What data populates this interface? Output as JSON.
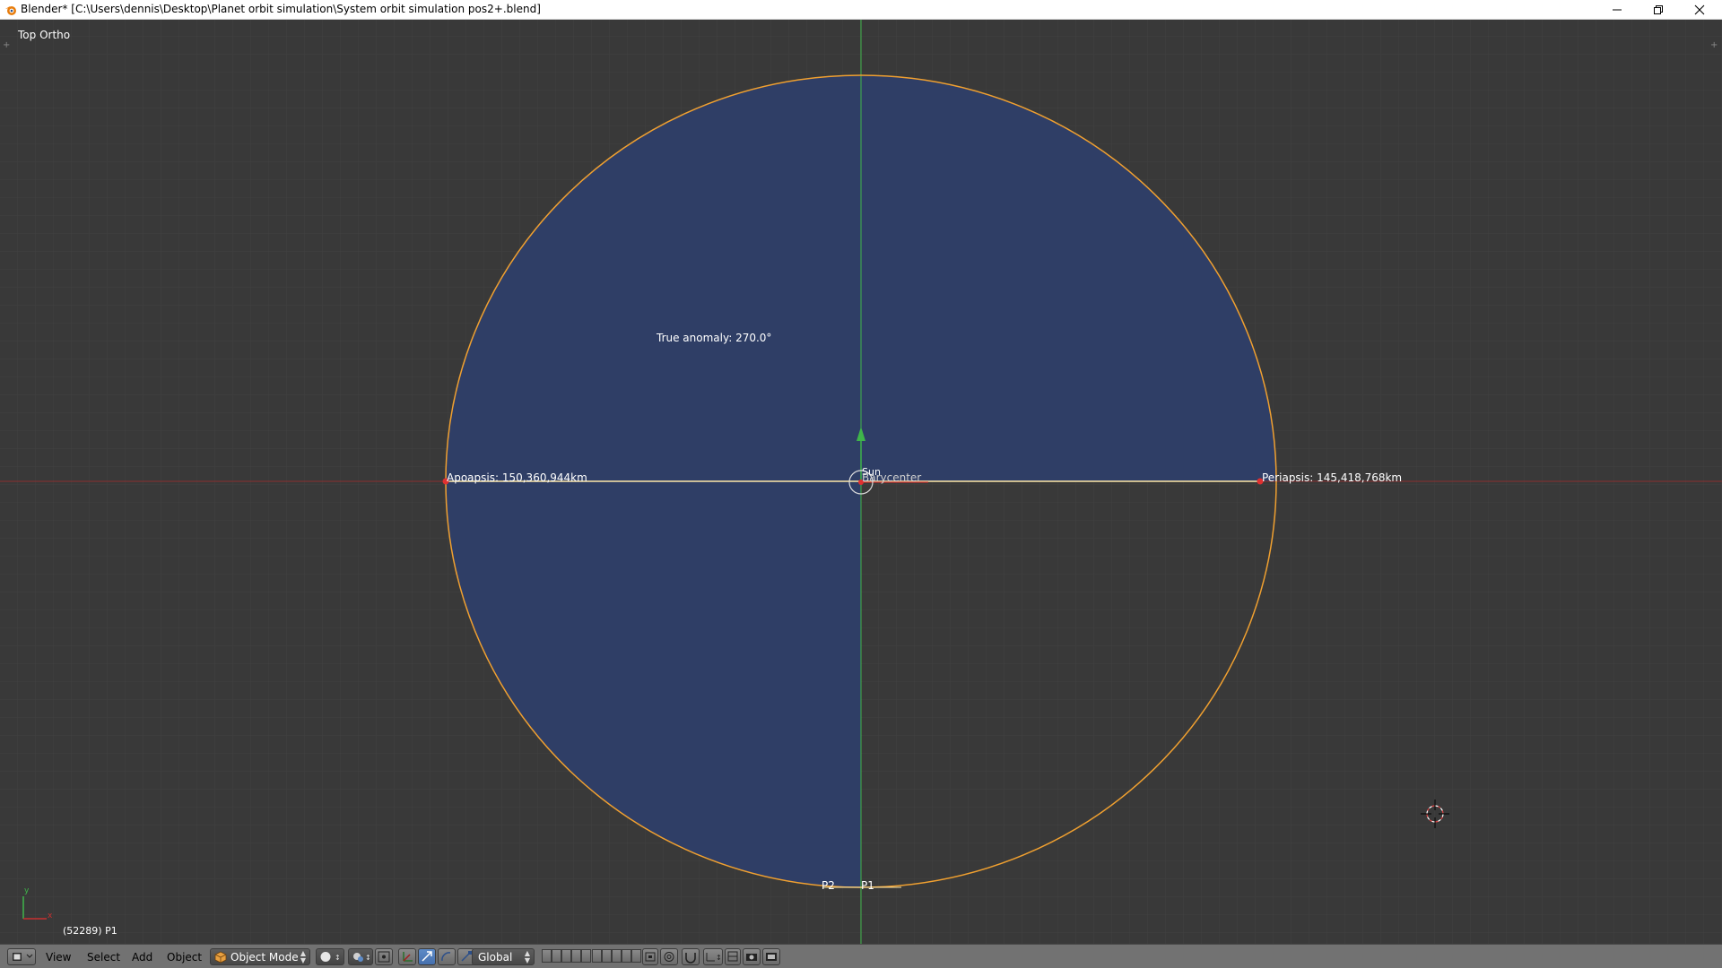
{
  "window": {
    "title": "Blender* [C:\\Users\\dennis\\Desktop\\Planet orbit simulation\\System orbit simulation pos2+.blend]"
  },
  "viewport": {
    "view_name": "Top Ortho",
    "frame_info": "(52289) P1",
    "axis_x": "x",
    "axis_y": "y",
    "labels": {
      "true_anomaly": "True anomaly: 270.0°",
      "apoapsis": "Apoapsis: 150,360,944km",
      "periapsis": "Periapsis: 145,418,768km",
      "sun": "Sun",
      "barycenter": "Barycenter",
      "p1": "P1",
      "p2": "P2"
    },
    "colors": {
      "background": "#393939",
      "orbit": "#f0a030",
      "fill": "#2f3e66",
      "y_axis": "#3fb54a",
      "x_axis": "#8a2f2f",
      "major_axis": "#ffe9a8"
    }
  },
  "header": {
    "editor_icon": "3d-view-icon",
    "menus": [
      "View",
      "Select",
      "Add",
      "Object"
    ],
    "mode": "Object Mode",
    "orientation": "Global"
  }
}
